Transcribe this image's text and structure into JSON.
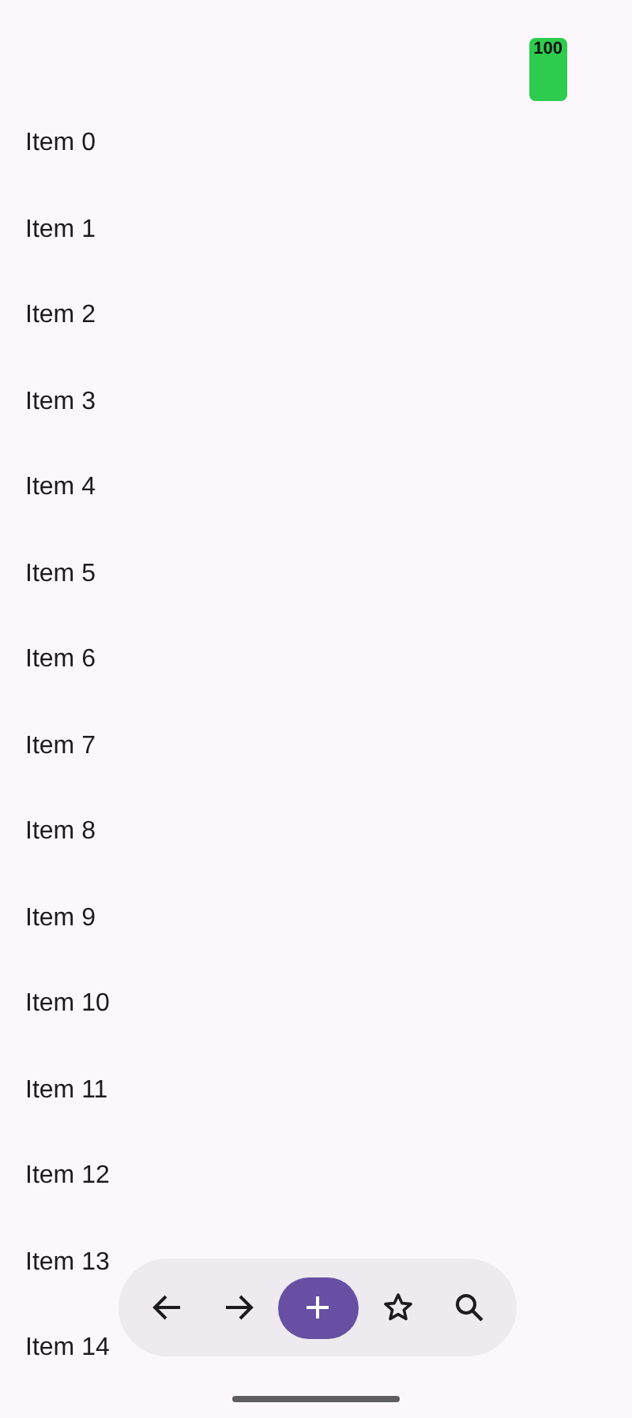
{
  "status_bar": {
    "battery": "100"
  },
  "items": [
    "Item 0",
    "Item 1",
    "Item 2",
    "Item 3",
    "Item 4",
    "Item 5",
    "Item 6",
    "Item 7",
    "Item 8",
    "Item 9",
    "Item 10",
    "Item 11",
    "Item 12",
    "Item 13",
    "Item 14"
  ]
}
